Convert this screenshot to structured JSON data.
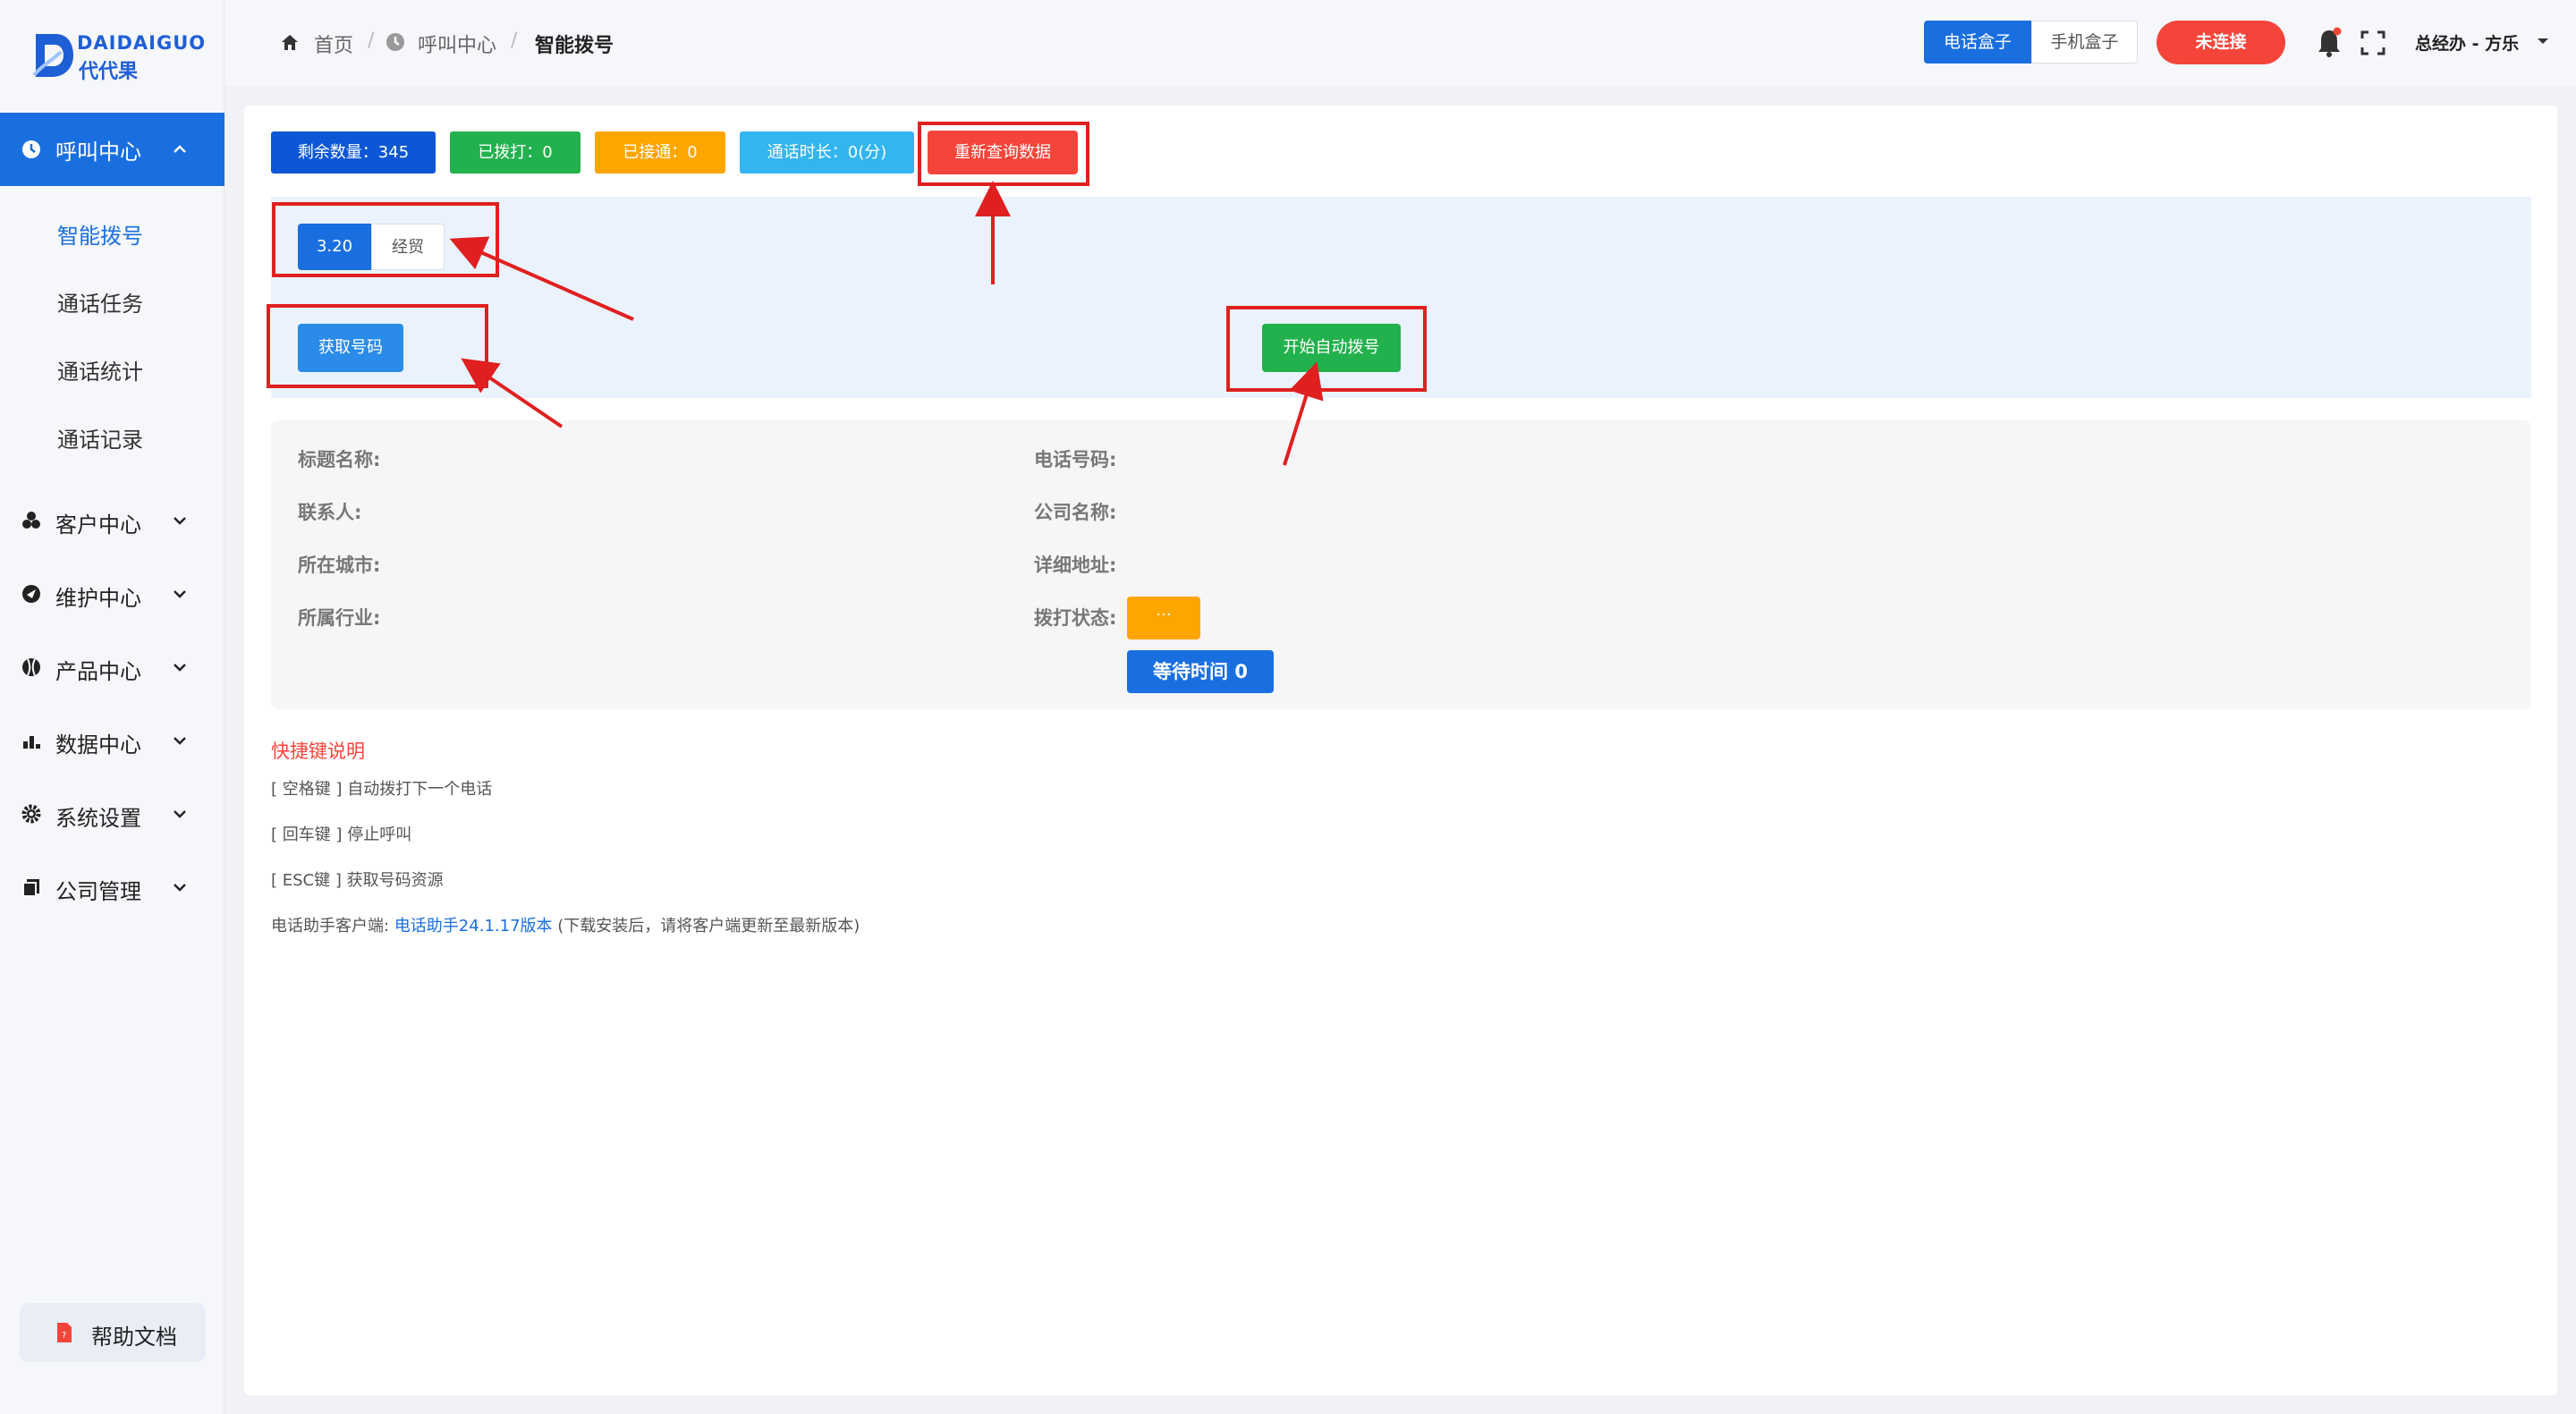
{
  "logo": {
    "en": "DAIDAIGUO",
    "cn": "代代果"
  },
  "sidebar": {
    "active_group": "呼叫中心",
    "sub_items": [
      "智能拨号",
      "通话任务",
      "通话统计",
      "通话记录"
    ],
    "groups": [
      "客户中心",
      "维护中心",
      "产品中心",
      "数据中心",
      "系统设置",
      "公司管理"
    ],
    "help": "帮助文档"
  },
  "breadcrumb": {
    "home": "首页",
    "section": "呼叫中心",
    "current": "智能拨号"
  },
  "header": {
    "device_tab_phone": "电话盒子",
    "device_tab_mobile": "手机盒子",
    "status": "未连接",
    "user": "总经办 - 方乐"
  },
  "stats": {
    "remaining": "剩余数量：345",
    "dialed": "已拨打：0",
    "connected": "已接通：0",
    "duration": "通话时长：0(分)",
    "requery": "重新查询数据"
  },
  "tabs": [
    "3.20",
    "经贸"
  ],
  "actions": {
    "get_number": "获取号码",
    "auto_dial": "开始自动拨号"
  },
  "fields": {
    "title": "标题名称:",
    "contact": "联系人:",
    "city": "所在城市:",
    "industry": "所属行业:",
    "phone": "电话号码:",
    "company": "公司名称:",
    "address": "详细地址:",
    "dial_status": "拨打状态:"
  },
  "dial_status_value": "···",
  "wait_time": "等待时间 0",
  "shortcuts": {
    "title": "快捷键说明",
    "space": "[ 空格键 ] 自动拨打下一个电话",
    "enter": "[ 回车键 ] 停止呼叫",
    "esc": "[ ESC键 ] 获取号码资源",
    "client_prefix": "电话助手客户端:",
    "client_link": "电话助手24.1.17版本",
    "client_suffix": "(下载安装后，请将客户端更新至最新版本)"
  },
  "colors": {
    "primary": "#1a6fe0",
    "danger": "#f5453a",
    "success": "#22b14c",
    "warning": "#ffa500",
    "info": "#33b5f0"
  }
}
